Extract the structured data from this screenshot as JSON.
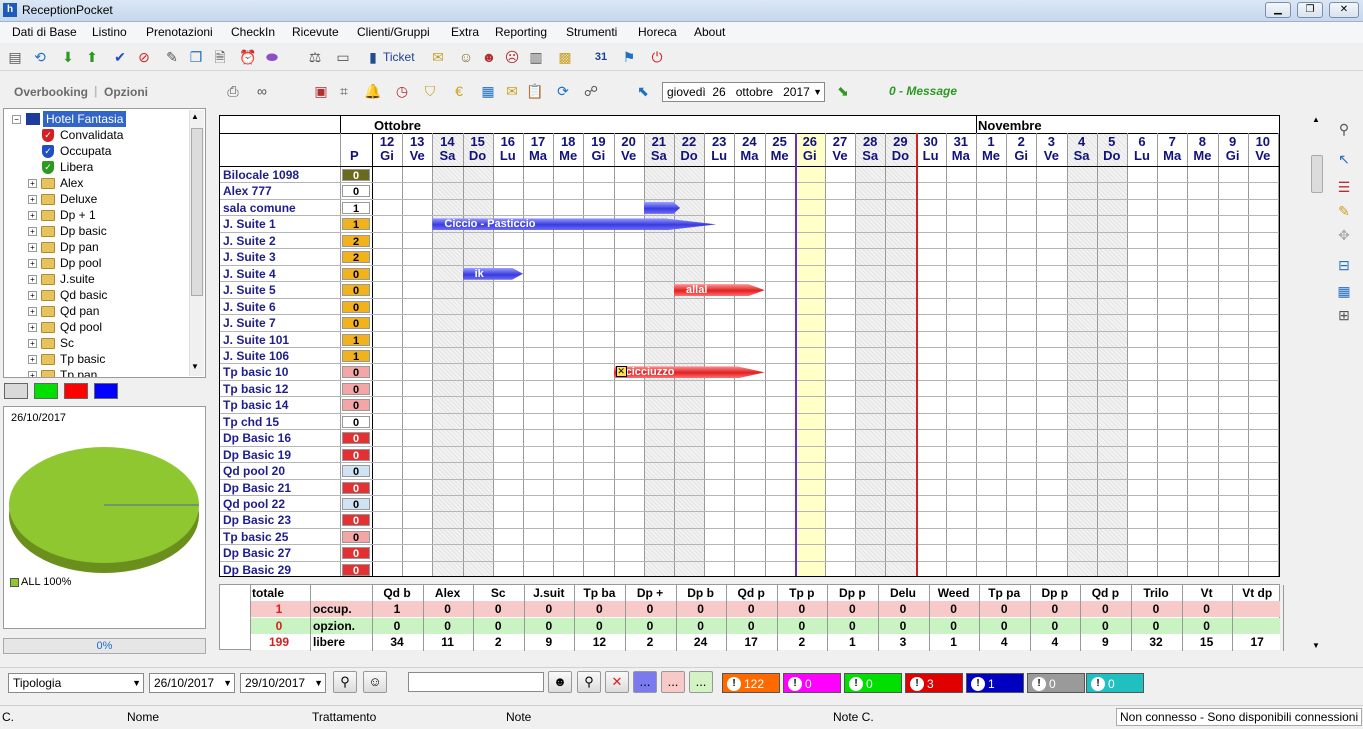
{
  "window": {
    "title": "ReceptionPocket"
  },
  "menu": [
    "Dati di Base",
    "Listino",
    "Prenotazioni",
    "CheckIn",
    "Ricevute",
    "Clienti/Gruppi",
    "Extra",
    "Reporting",
    "Strumenti",
    "Horeca",
    "About"
  ],
  "toolbar": {
    "ticket_label": "Ticket"
  },
  "left_tabs": {
    "overbooking": "Overbooking",
    "opzioni": "Opzioni"
  },
  "tree": {
    "root": "Hotel Fantasia",
    "status_items": [
      "Convalidata",
      "Occupata",
      "Libera"
    ],
    "groups": [
      "Alex",
      "Deluxe",
      "Dp + 1",
      "Dp basic",
      "Dp pan",
      "Dp pool",
      "J.suite",
      "Qd basic",
      "Qd pan",
      "Qd pool",
      "Sc",
      "Tp basic",
      "Tp pan"
    ]
  },
  "colors": {
    "swatches": [
      "#d9d9d9",
      "#00e000",
      "#ff0000",
      "#0000ff"
    ],
    "pie": "#8ec72f"
  },
  "pie": {
    "date": "26/10/2017",
    "legend": "ALL 100%"
  },
  "progress": {
    "value": 0,
    "label": "0%"
  },
  "planner_toolbar": {
    "weekday": "giovedì",
    "day": "26",
    "month": "ottobre",
    "year": "2017",
    "message": "0 - Message"
  },
  "calendar": {
    "months": [
      {
        "name": "Ottobre"
      },
      {
        "name": "Novembre"
      }
    ],
    "p_header": "P",
    "days": [
      {
        "n": "12",
        "d": "Gi"
      },
      {
        "n": "13",
        "d": "Ve"
      },
      {
        "n": "14",
        "d": "Sa"
      },
      {
        "n": "15",
        "d": "Do"
      },
      {
        "n": "16",
        "d": "Lu"
      },
      {
        "n": "17",
        "d": "Ma"
      },
      {
        "n": "18",
        "d": "Me"
      },
      {
        "n": "19",
        "d": "Gi"
      },
      {
        "n": "20",
        "d": "Ve"
      },
      {
        "n": "21",
        "d": "Sa"
      },
      {
        "n": "22",
        "d": "Do"
      },
      {
        "n": "23",
        "d": "Lu"
      },
      {
        "n": "24",
        "d": "Ma"
      },
      {
        "n": "25",
        "d": "Me"
      },
      {
        "n": "26",
        "d": "Gi"
      },
      {
        "n": "27",
        "d": "Ve"
      },
      {
        "n": "28",
        "d": "Sa"
      },
      {
        "n": "29",
        "d": "Do"
      },
      {
        "n": "30",
        "d": "Lu"
      },
      {
        "n": "31",
        "d": "Ma"
      },
      {
        "n": "1",
        "d": "Me"
      },
      {
        "n": "2",
        "d": "Gi"
      },
      {
        "n": "3",
        "d": "Ve"
      },
      {
        "n": "4",
        "d": "Sa"
      },
      {
        "n": "5",
        "d": "Do"
      },
      {
        "n": "6",
        "d": "Lu"
      },
      {
        "n": "7",
        "d": "Ma"
      },
      {
        "n": "8",
        "d": "Me"
      },
      {
        "n": "9",
        "d": "Gi"
      },
      {
        "n": "10",
        "d": "Ve"
      }
    ],
    "rooms": [
      {
        "name": "Bilocale 1098",
        "p": "0",
        "pcolor": "#6b6b1e"
      },
      {
        "name": "Alex 777",
        "p": "0",
        "pcolor": "#ffffff"
      },
      {
        "name": "sala comune",
        "p": "1",
        "pcolor": "#ffffff"
      },
      {
        "name": "J. Suite 1",
        "p": "1",
        "pcolor": "#f2b21b"
      },
      {
        "name": "J. Suite 2",
        "p": "2",
        "pcolor": "#f2b21b"
      },
      {
        "name": "J. Suite 3",
        "p": "2",
        "pcolor": "#f2b21b"
      },
      {
        "name": "J. Suite 4",
        "p": "0",
        "pcolor": "#f2b21b"
      },
      {
        "name": "J. Suite 5",
        "p": "0",
        "pcolor": "#f2b21b"
      },
      {
        "name": "J. Suite 6",
        "p": "0",
        "pcolor": "#f2b21b"
      },
      {
        "name": "J. Suite 7",
        "p": "0",
        "pcolor": "#f2b21b"
      },
      {
        "name": "J. Suite 101",
        "p": "1",
        "pcolor": "#f2b21b"
      },
      {
        "name": "J. Suite 106",
        "p": "1",
        "pcolor": "#f2b21b"
      },
      {
        "name": "Tp basic 10",
        "p": "0",
        "pcolor": "#f4a6a6"
      },
      {
        "name": "Tp basic 12",
        "p": "0",
        "pcolor": "#f4a6a6"
      },
      {
        "name": "Tp basic 14",
        "p": "0",
        "pcolor": "#f4a6a6"
      },
      {
        "name": "Tp chd 15",
        "p": "0",
        "pcolor": "#ffffff"
      },
      {
        "name": "Dp Basic 16",
        "p": "0",
        "pcolor": "#e43030"
      },
      {
        "name": "Dp Basic 19",
        "p": "0",
        "pcolor": "#e43030"
      },
      {
        "name": "Qd pool 20",
        "p": "0",
        "pcolor": "#cfe3f5"
      },
      {
        "name": "Dp Basic 21",
        "p": "0",
        "pcolor": "#e43030"
      },
      {
        "name": "Qd pool 22",
        "p": "0",
        "pcolor": "#cfe3f5"
      },
      {
        "name": "Dp Basic 23",
        "p": "0",
        "pcolor": "#e43030"
      },
      {
        "name": "Tp basic 25",
        "p": "0",
        "pcolor": "#f4a6a6"
      },
      {
        "name": "Dp Basic 27",
        "p": "0",
        "pcolor": "#e43030"
      },
      {
        "name": "Dp Basic 29",
        "p": "0",
        "pcolor": "#e43030"
      }
    ],
    "bookings": [
      {
        "label": "",
        "row": 2,
        "start": 9,
        "days": 1.2,
        "color": "blue"
      },
      {
        "label": "Ciccio - Pasticcio",
        "row": 3,
        "start": 2,
        "days": 9.4,
        "color": "blue"
      },
      {
        "label": "ik",
        "row": 6,
        "start": 3,
        "days": 2,
        "color": "blue"
      },
      {
        "label": "allal",
        "row": 7,
        "start": 10,
        "days": 3,
        "color": "red"
      },
      {
        "label": "cicciuzzo",
        "row": 12,
        "start": 8,
        "days": 5,
        "color": "red"
      }
    ]
  },
  "stats": {
    "total_label": "totale",
    "rows": [
      {
        "total": "1",
        "label": "occup.",
        "values": [
          "1",
          "0",
          "0",
          "0",
          "0",
          "0",
          "0",
          "0",
          "0",
          "0",
          "0",
          "0",
          "0",
          "0",
          "0",
          "0",
          "0"
        ]
      },
      {
        "total": "0",
        "label": "opzion.",
        "values": [
          "0",
          "0",
          "0",
          "0",
          "0",
          "0",
          "0",
          "0",
          "0",
          "0",
          "0",
          "0",
          "0",
          "0",
          "0",
          "0",
          "0"
        ]
      },
      {
        "total": "199",
        "label": "libere",
        "values": [
          "34",
          "11",
          "2",
          "9",
          "12",
          "2",
          "24",
          "17",
          "2",
          "1",
          "3",
          "1",
          "4",
          "4",
          "9",
          "32",
          "15",
          "17"
        ]
      }
    ],
    "columns": [
      "Qd b",
      "Alex",
      "Sc",
      "J.suit",
      "Tp ba",
      "Dp +",
      "Dp b",
      "Qd p",
      "Tp p",
      "Dp p",
      "Delu",
      "Weed",
      "Tp pa",
      "Dp p",
      "Qd p",
      "Trilo",
      "Vt",
      "Vt dp"
    ]
  },
  "bottom": {
    "tipologia": "Tipologia",
    "date_from": "26/10/2017",
    "date_to": "29/10/2017",
    "search_value": "",
    "badges": [
      {
        "value": "122",
        "color": "#ff6a00"
      },
      {
        "value": "0",
        "color": "#ff00ff"
      },
      {
        "value": "0",
        "color": "#00e000"
      },
      {
        "value": "3",
        "color": "#e00000"
      },
      {
        "value": "1",
        "color": "#0000c0"
      },
      {
        "value": "0",
        "color": "#9a9a9a"
      },
      {
        "value": "0",
        "color": "#20c0c0"
      }
    ]
  },
  "statusbar": {
    "c": "C.",
    "nome": "Nome",
    "trattamento": "Trattamento",
    "note": "Note",
    "note_c": "Note C.",
    "connection": "Non connesso - Sono disponibili connessioni"
  }
}
